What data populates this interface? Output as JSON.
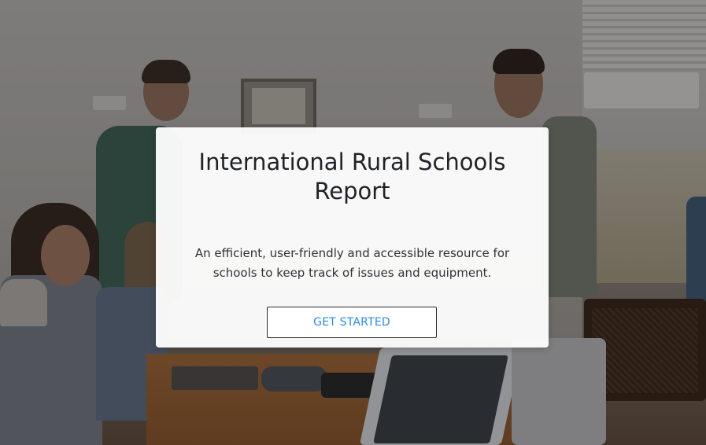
{
  "hero": {
    "title": "International Rural Schools Report",
    "description": "An efficient, user-friendly and accessible resource for schools to keep track of issues and equipment.",
    "cta_label": "GET STARTED"
  },
  "colors": {
    "cta_text": "#2d89e6",
    "title_text": "#1f2327",
    "card_background": "#ffffff"
  }
}
